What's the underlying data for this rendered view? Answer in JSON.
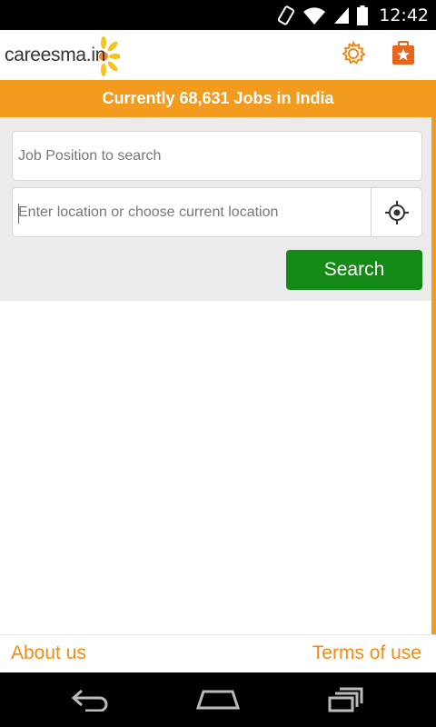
{
  "status_bar": {
    "time": "12:42",
    "icons": [
      "screen-rotation-icon",
      "wifi-icon",
      "cellular-signal-icon",
      "battery-icon"
    ]
  },
  "header": {
    "logo_text": "careesma.in",
    "icons": [
      "gear-icon",
      "saved-jobs-star-icon"
    ]
  },
  "banner": {
    "text": "Currently 68,631 Jobs in India"
  },
  "search": {
    "job_placeholder": "Job Position to search",
    "job_value": "",
    "location_placeholder": "Enter location or choose current location",
    "location_value": "",
    "locate_icon": "crosshair-icon",
    "button_label": "Search"
  },
  "footer": {
    "about_label": "About us",
    "terms_label": "Terms of use"
  },
  "nav_bar": {
    "icons": [
      "back-icon",
      "home-icon",
      "recent-apps-icon"
    ]
  },
  "colors": {
    "accent": "#f39b1f",
    "link": "#f18b16",
    "search_button": "#138a16",
    "search_background": "#ebebeb"
  }
}
